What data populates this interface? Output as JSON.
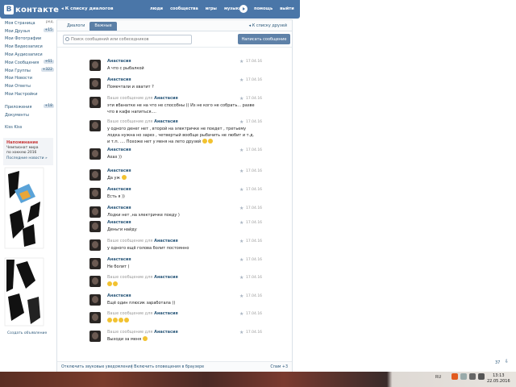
{
  "header": {
    "logo_letter": "В",
    "logo_text": "контакте",
    "back_link": "К списку диалогов",
    "nav": [
      "люди",
      "сообщества",
      "игры",
      "музыка"
    ],
    "nav2": [
      "помощь",
      "выйти"
    ]
  },
  "sidebar": {
    "items": [
      {
        "label": "Моя Страница",
        "extra": "ред.",
        "count": ""
      },
      {
        "label": "Мои Друзья",
        "extra": "",
        "count": "+15"
      },
      {
        "label": "Мои Фотографии",
        "extra": "",
        "count": ""
      },
      {
        "label": "Мои Видеозаписи",
        "extra": "",
        "count": ""
      },
      {
        "label": "Мои Аудиозаписи",
        "extra": "",
        "count": ""
      },
      {
        "label": "Мои Сообщения",
        "extra": "",
        "count": "+61"
      },
      {
        "label": "Мои Группы",
        "extra": "",
        "count": "+322"
      },
      {
        "label": "Мои Новости",
        "extra": "",
        "count": ""
      },
      {
        "label": "Мои Ответы",
        "extra": "",
        "count": ""
      },
      {
        "label": "Мои Настройки",
        "extra": "",
        "count": ""
      }
    ],
    "items2": [
      {
        "label": "Приложения",
        "count": "+18"
      },
      {
        "label": "Документы",
        "count": ""
      }
    ],
    "items3": [
      {
        "label": "Kiss Kiss",
        "count": ""
      }
    ],
    "promo": {
      "heading": "Напоминание",
      "line1": "Чемпионат мира",
      "line2": "по хоккею 2016",
      "link": "Последние новости »"
    },
    "create_ad": "Создать объявление"
  },
  "tabs": {
    "items": [
      "Диалоги",
      "Важные"
    ],
    "active": 1,
    "friends_link": "К списку друзей"
  },
  "search": {
    "placeholder": "Поиск сообщений или собеседников"
  },
  "compose_label": "Написать сообщение",
  "messages": [
    {
      "prefix": "",
      "name": "Анастасия",
      "text": "А что с рыбалкой",
      "emoji": 0,
      "date": "17.04.16"
    },
    {
      "prefix": "",
      "name": "Анастасия",
      "text": "Помечтали и хватит ?",
      "emoji": 0,
      "date": "17.04.16"
    },
    {
      "prefix": "Ваше сообщение для",
      "name": "Анастасия",
      "text": "эти вбанатке не на что не способны (( Из не кого не собрать... разве что в кафе напиться....",
      "emoji": 0,
      "date": "17.04.16"
    },
    {
      "prefix": "Ваше сообщение для",
      "name": "Анастасия",
      "text": "у одного денег нет , второй на электричке не поедет , третьему лодка нужна но зарез , четвертый вообще рыбачить не любит и т.д. и т.п. .... Похоже нет у меня на лето друзей",
      "emoji": 2,
      "date": "17.04.16"
    },
    {
      "prefix": "",
      "name": "Анастасия",
      "text": "Ахах ))",
      "emoji": 0,
      "date": "17.04.16"
    },
    {
      "prefix": "",
      "name": "Анастасия",
      "text": "Да уж",
      "emoji": 1,
      "date": "17.04.16"
    },
    {
      "prefix": "",
      "name": "Анастасия",
      "text": "Есть я ))",
      "emoji": 0,
      "date": "17.04.16"
    },
    {
      "prefix": "",
      "name": "Анастасия",
      "text": "Лодки нет ,на электричке поеду )",
      "emoji": 0,
      "date": "17.04.16"
    },
    {
      "prefix": "",
      "name": "Анастасия",
      "text": "Деньги найду",
      "emoji": 0,
      "date": "17.04.16"
    },
    {
      "prefix": "Ваше сообщение для",
      "name": "Анастасия",
      "text": "у одного ещё голова болит постоянно",
      "emoji": 0,
      "date": "17.04.16"
    },
    {
      "prefix": "",
      "name": "Анастасия",
      "text": "Не болит )",
      "emoji": 0,
      "date": "17.04.16"
    },
    {
      "prefix": "Ваше сообщение для",
      "name": "Анастасия",
      "text": "",
      "emoji": 2,
      "date": "17.04.16"
    },
    {
      "prefix": "",
      "name": "Анастасия",
      "text": "Ещё один плюсик заработала ))",
      "emoji": 0,
      "date": "17.04.16"
    },
    {
      "prefix": "Ваше сообщение для",
      "name": "Анастасия",
      "text": "",
      "emoji": 4,
      "date": "17.04.16"
    },
    {
      "prefix": "Ваше сообщение для",
      "name": "Анастасия",
      "text": "Выходи за меня",
      "emoji": 1,
      "date": "17.04.16"
    }
  ],
  "footer": {
    "sound": "Отключить звуковые уведомления",
    "notify": "Включить оповещения в браузере",
    "spam": "Спам +3"
  },
  "online_count": "37",
  "taskbar": {
    "lang": "RU",
    "time": "13:13",
    "date": "22.05.2016"
  }
}
